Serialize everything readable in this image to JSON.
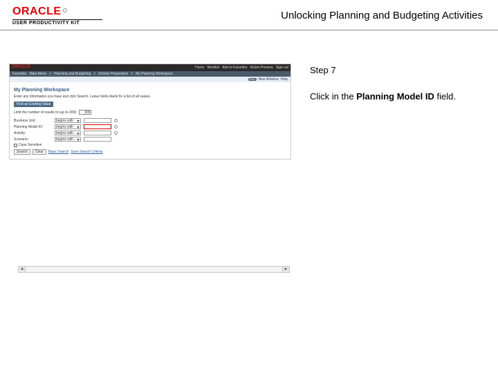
{
  "brand": {
    "logo_text": "ORACLE",
    "sub_text": "USER PRODUCTIVITY KIT"
  },
  "title": "Unlocking Planning and Budgeting Activities",
  "step": {
    "label": "Step 7",
    "instruction_prefix": "Click in the ",
    "instruction_bold": "Planning Model ID",
    "instruction_suffix": " field."
  },
  "app": {
    "brand": "ORACLE",
    "top_links": [
      "Home",
      "Worklist",
      "Add to Favorites",
      "Action Preview",
      "Sign out"
    ],
    "crumbs": [
      "Favorites",
      "Main Menu",
      "Planning and Budgeting",
      "Activity Preparation",
      "My Planning Workspace"
    ],
    "subbar": {
      "pill": "New",
      "tag": "New Window",
      "help": "Help"
    },
    "page_title": "My Planning Workspace",
    "page_sub": "Enter any information you have and click Search. Leave fields blank for a list of all values.",
    "find_button": "Find an Existing Value",
    "limit_label": "Limit the number of results to (up to 300):",
    "limit_value": "300",
    "rows": [
      {
        "label": "Business Unit:",
        "op": "begins with",
        "highlight": false
      },
      {
        "label": "Planning Model ID:",
        "op": "begins with",
        "highlight": true
      },
      {
        "label": "Activity:",
        "op": "begins with",
        "highlight": false
      },
      {
        "label": "Scenario:",
        "op": "begins with",
        "highlight": false
      }
    ],
    "case_checkbox": "Case Sensitive",
    "buttons": {
      "search": "Search",
      "clear": "Clear"
    },
    "links": {
      "basic": "Basic Search",
      "save": "Save Search Criteria"
    }
  }
}
